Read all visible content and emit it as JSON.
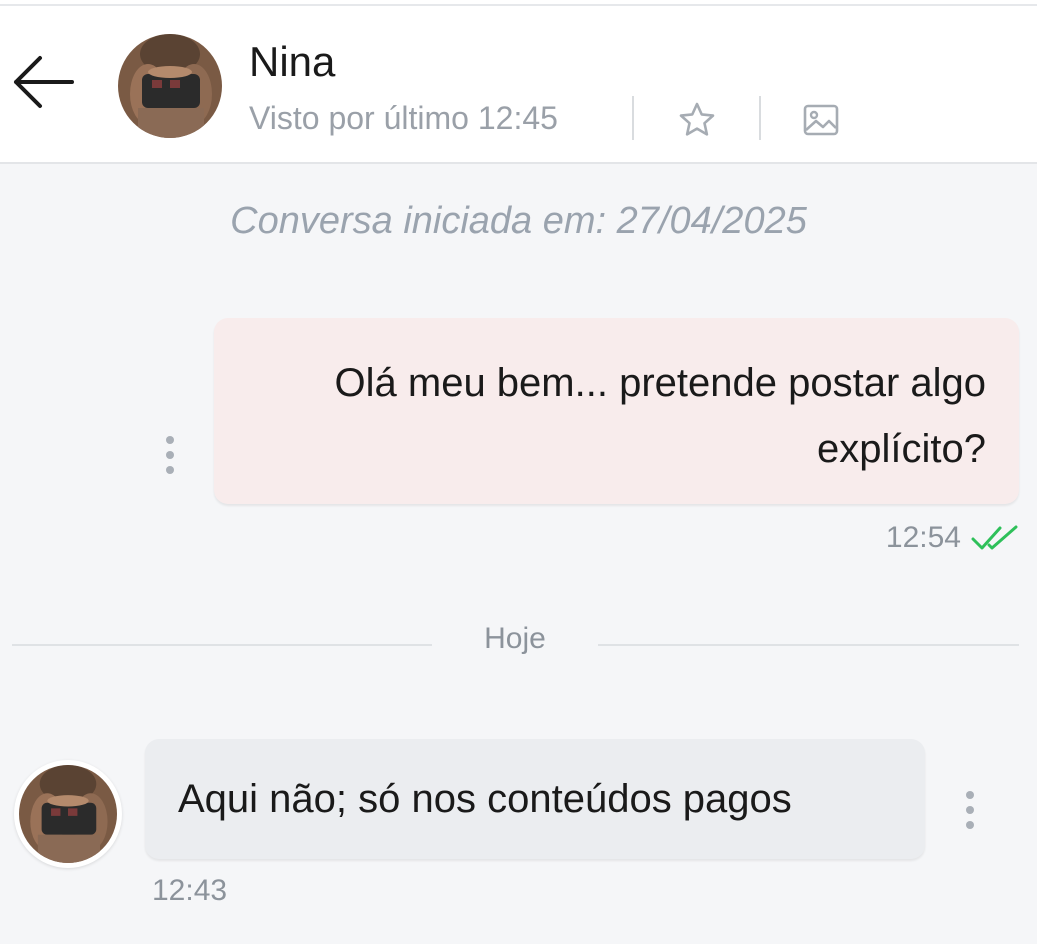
{
  "header": {
    "contact_name": "Nina",
    "last_seen": "Visto por último 12:45",
    "icons": {
      "back": "arrow-left-icon",
      "favorite": "star-icon",
      "media": "image-icon"
    }
  },
  "conversation": {
    "started_label": "Conversa iniciada em: 27/04/2025",
    "messages": [
      {
        "direction": "outgoing",
        "text": "Olá meu bem... pretende postar algo explícito?",
        "time": "12:54",
        "status": "read",
        "status_icon": "double-check-icon"
      },
      {
        "direction": "incoming",
        "text": "Aqui não; só nos conteúdos pagos",
        "time": "12:43"
      }
    ],
    "day_separator": "Hoje"
  },
  "colors": {
    "outgoing_bubble": "#f8ecec",
    "incoming_bubble": "#ebedf0",
    "read_check": "#2ec05a",
    "muted_text": "#8c939b"
  }
}
